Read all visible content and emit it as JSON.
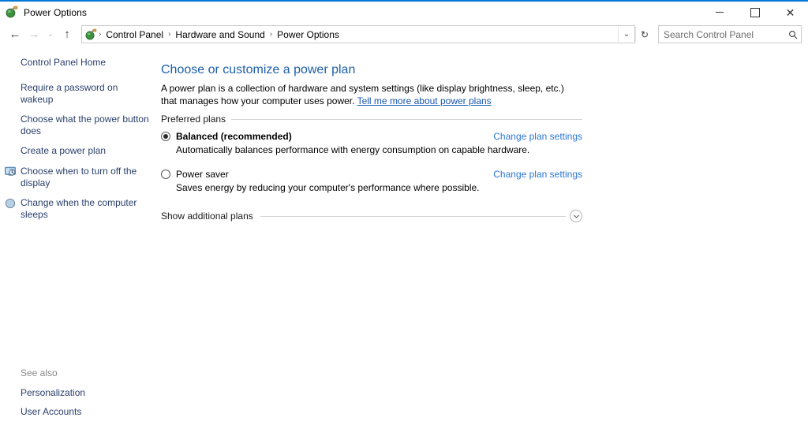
{
  "window": {
    "title": "Power Options",
    "app_icon": "power-plug-icon",
    "accent_color": "#0078d7",
    "controls": {
      "minimize": "–",
      "maximize": "☐",
      "close": "✕"
    }
  },
  "toolbar": {
    "back_icon": "←",
    "forward_icon": "→",
    "recent_icon": "⌄",
    "up_icon": "↑",
    "address_icon": "power-plug-icon",
    "breadcrumbs": [
      "Control Panel",
      "Hardware and Sound",
      "Power Options"
    ],
    "breadcrumb_separator": "›",
    "dropdown_icon": "⌄",
    "refresh_icon": "↻",
    "search": {
      "placeholder": "Search Control Panel",
      "value": "",
      "icon": "search-icon"
    }
  },
  "help": {
    "label": "?"
  },
  "sidebar": {
    "home_label": "Control Panel Home",
    "items": [
      {
        "label": "Require a password on wakeup",
        "icon": ""
      },
      {
        "label": "Choose what the power button does",
        "icon": ""
      },
      {
        "label": "Create a power plan",
        "icon": ""
      },
      {
        "label": "Choose when to turn off the display",
        "icon": "display-clock-icon"
      },
      {
        "label": "Change when the computer sleeps",
        "icon": "sleep-moon-icon"
      }
    ],
    "see_also": {
      "title": "See also",
      "links": [
        "Personalization",
        "User Accounts"
      ]
    }
  },
  "main": {
    "title": "Choose or customize a power plan",
    "description_part1": "A power plan is a collection of hardware and system settings (like display brightness, sleep, etc.) that manages how your computer uses power. ",
    "description_link": "Tell me more about power plans",
    "group_label": "Preferred plans",
    "plans": [
      {
        "name": "Balanced (recommended)",
        "description": "Automatically balances performance with energy consumption on capable hardware.",
        "selected": true,
        "link": "Change plan settings"
      },
      {
        "name": "Power saver",
        "description": "Saves energy by reducing your computer's performance where possible.",
        "selected": false,
        "link": "Change plan settings"
      }
    ],
    "expander": {
      "label": "Show additional plans",
      "icon": "chevron-down-icon",
      "glyph": "⌄"
    }
  },
  "colors": {
    "accent": "#0078d7",
    "title_blue": "#1d5fa8",
    "link_blue": "#2a76d2",
    "sidebar_link": "#2a3f6b",
    "inline_link": "#1757b0",
    "muted": "#8a8a8a"
  }
}
